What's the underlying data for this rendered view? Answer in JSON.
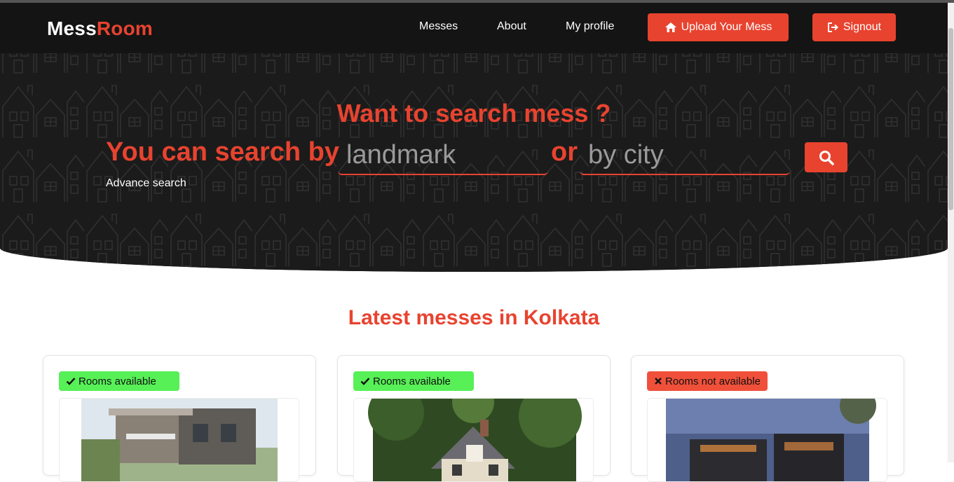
{
  "brand": {
    "part1": "Mess",
    "part2": "Room",
    "accent_color": "#e8432f"
  },
  "nav": {
    "links": [
      "Messes",
      "About",
      "My profile"
    ],
    "upload_label": "Upload Your Mess",
    "upload_icon": "home-icon",
    "signout_label": "Signout",
    "signout_icon": "sign-out-icon"
  },
  "hero": {
    "title": "Want to search mess ?",
    "subtitle": "You can search by",
    "landmark_placeholder": "landmark",
    "or_text": "or",
    "city_placeholder": "by city",
    "search_icon": "search-icon",
    "advance_search": "Advance search"
  },
  "latest": {
    "title": "Latest messes in Kolkata",
    "cards": [
      {
        "status": "Rooms available",
        "available": true,
        "status_icon": "check-icon",
        "status_color": "#57f057"
      },
      {
        "status": "Rooms available",
        "available": true,
        "status_icon": "check-icon",
        "status_color": "#57f057"
      },
      {
        "status": "Rooms not available",
        "available": false,
        "status_icon": "cross-icon",
        "status_color": "#f0503a"
      }
    ]
  }
}
